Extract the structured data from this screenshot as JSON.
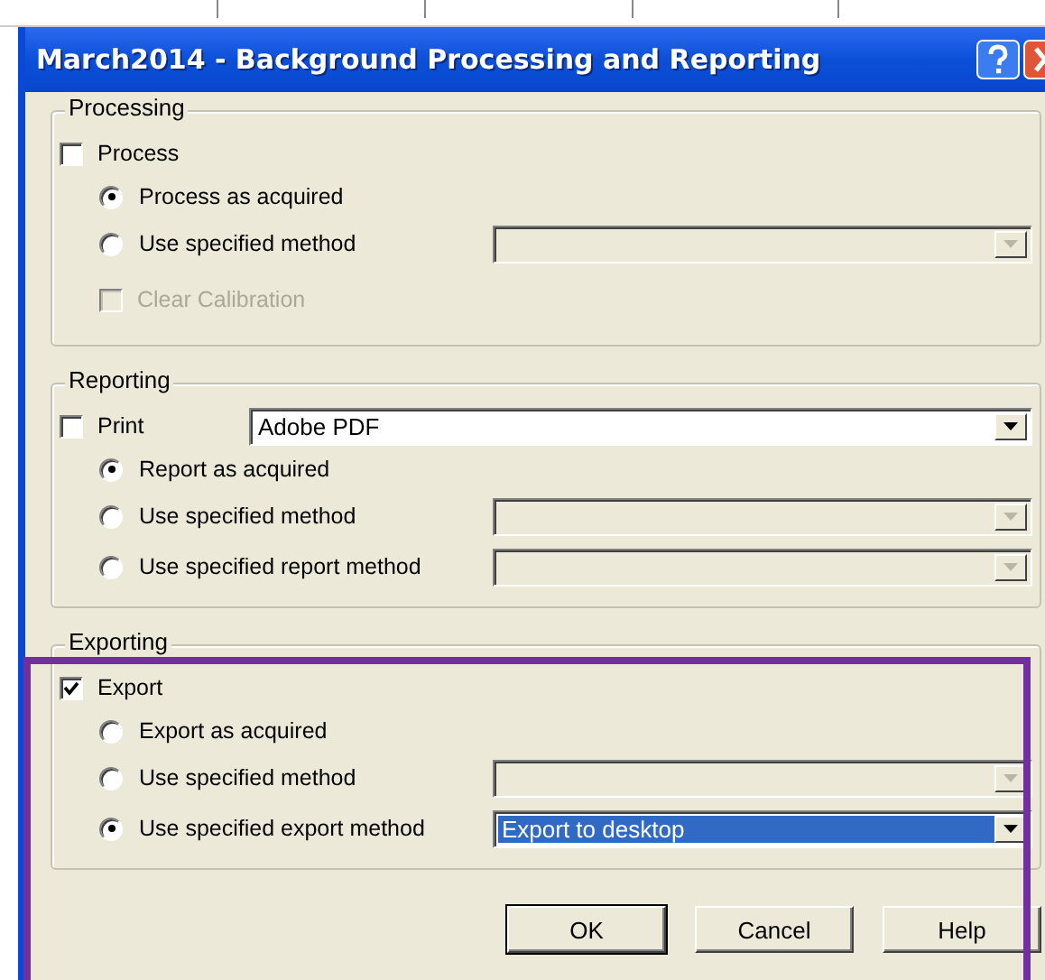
{
  "window": {
    "title": "March2014 - Background Processing and Reporting"
  },
  "sections": [
    {
      "legend": "Processing",
      "highlighted": false,
      "checkbox": {
        "label": "Process",
        "checked": false,
        "disabled": false
      },
      "children": [
        {
          "kind": "radio",
          "label": "Process as acquired",
          "selected": true
        },
        {
          "kind": "radio",
          "label": "Use specified method",
          "selected": false,
          "combo": {
            "disabled": true,
            "highlighted": false
          }
        },
        {
          "kind": "checkbox",
          "label": "Clear Calibration",
          "checked": false,
          "disabled": true
        }
      ]
    },
    {
      "legend": "Reporting",
      "highlighted": false,
      "checkbox": {
        "label": "Print",
        "checked": false,
        "disabled": false,
        "combo": {
          "value": "Adobe PDF",
          "disabled": false,
          "highlighted": false
        }
      },
      "children": [
        {
          "kind": "radio",
          "label": "Report as acquired",
          "selected": true
        },
        {
          "kind": "radio",
          "label": "Use specified method",
          "selected": false,
          "combo": {
            "disabled": true,
            "highlighted": false
          }
        },
        {
          "kind": "radio",
          "label": "Use specified report method",
          "selected": false,
          "combo": {
            "disabled": true,
            "highlighted": false
          }
        }
      ]
    },
    {
      "legend": "Exporting",
      "highlighted": true,
      "checkbox": {
        "label": "Export",
        "checked": true,
        "disabled": false
      },
      "children": [
        {
          "kind": "radio",
          "label": "Export as acquired",
          "selected": false
        },
        {
          "kind": "radio",
          "label": "Use specified method",
          "selected": false,
          "combo": {
            "disabled": true,
            "highlighted": false
          }
        },
        {
          "kind": "radio",
          "label": "Use specified export method",
          "selected": true,
          "combo": {
            "value": "Export to desktop",
            "disabled": false,
            "highlighted": true
          }
        }
      ]
    }
  ],
  "buttons": [
    {
      "label": "OK",
      "default": true
    },
    {
      "label": "Cancel",
      "default": false
    },
    {
      "label": "Help",
      "default": false
    }
  ]
}
